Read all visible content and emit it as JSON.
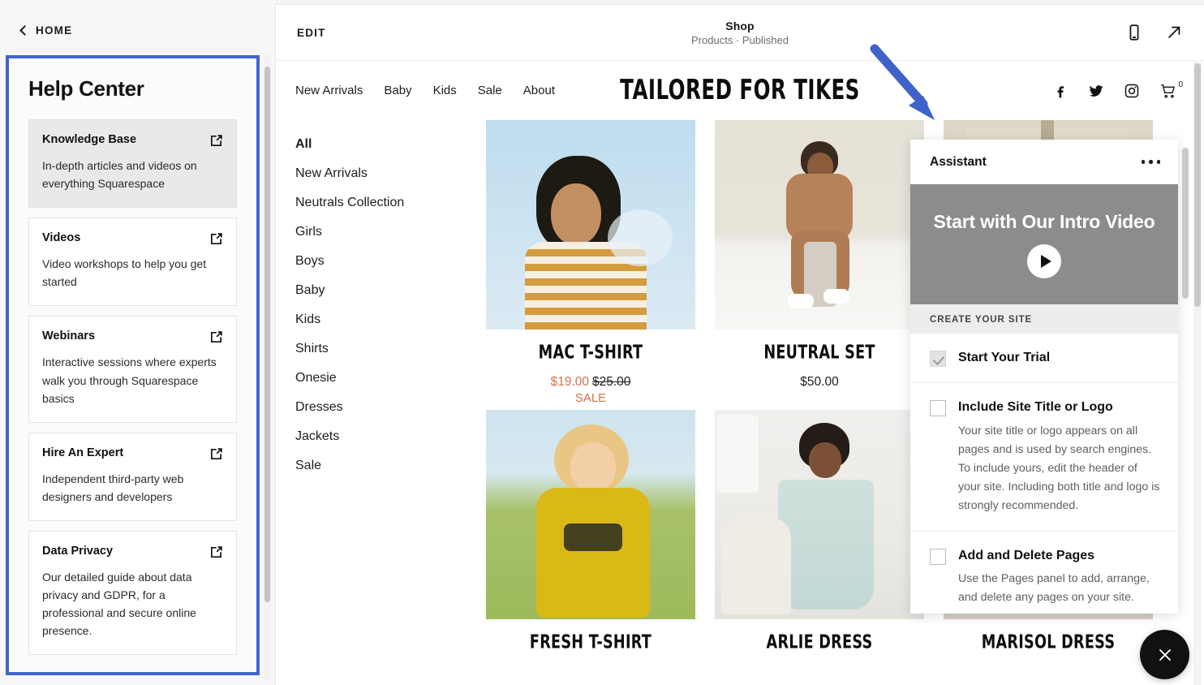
{
  "left_panel": {
    "back_label": "HOME",
    "back_icon": "chevron-left-icon",
    "title": "Help Center",
    "cards": [
      {
        "name": "Knowledge Base",
        "desc": "In-depth articles and videos on everything Squarespace",
        "icon": "external-link-icon",
        "active": true
      },
      {
        "name": "Videos",
        "desc": "Video workshops to help you get started",
        "icon": "external-link-icon",
        "active": false
      },
      {
        "name": "Webinars",
        "desc": "Interactive sessions where experts walk you through Squarespace basics",
        "icon": "external-link-icon",
        "active": false
      },
      {
        "name": "Hire An Expert",
        "desc": "Independent third-party web designers and developers",
        "icon": "external-link-icon",
        "active": false
      },
      {
        "name": "Data Privacy",
        "desc": "Our detailed guide about data privacy and GDPR, for a professional and secure online presence.",
        "icon": "external-link-icon",
        "active": false
      }
    ],
    "highlight_color": "#4264d0"
  },
  "topbar": {
    "edit_label": "EDIT",
    "page_title": "Shop",
    "page_subtitle": "Products · Published",
    "mobile_icon": "mobile-device-icon",
    "open_icon": "open-external-arrow-icon"
  },
  "site": {
    "brand": "TAILORED FOR TIKES",
    "nav": [
      {
        "label": "New Arrivals"
      },
      {
        "label": "Baby"
      },
      {
        "label": "Kids"
      },
      {
        "label": "Sale"
      },
      {
        "label": "About"
      }
    ],
    "social": [
      {
        "icon": "facebook-icon"
      },
      {
        "icon": "twitter-icon"
      },
      {
        "icon": "instagram-icon"
      }
    ],
    "cart": {
      "icon": "shopping-cart-icon",
      "count": "0"
    }
  },
  "categories": [
    {
      "label": "All",
      "active": true
    },
    {
      "label": "New Arrivals",
      "active": false
    },
    {
      "label": "Neutrals Collection",
      "active": false
    },
    {
      "label": "Girls",
      "active": false
    },
    {
      "label": "Boys",
      "active": false
    },
    {
      "label": "Baby",
      "active": false
    },
    {
      "label": "Kids",
      "active": false
    },
    {
      "label": "Shirts",
      "active": false
    },
    {
      "label": "Onesie",
      "active": false
    },
    {
      "label": "Dresses",
      "active": false
    },
    {
      "label": "Jackets",
      "active": false
    },
    {
      "label": "Sale",
      "active": false
    }
  ],
  "products": [
    {
      "title": "MAC T-SHIRT",
      "price": "$19.00",
      "original_price": "$25.00",
      "sale_label": "SALE",
      "on_sale": true
    },
    {
      "title": "NEUTRAL SET",
      "price": "$50.00",
      "original_price": "",
      "sale_label": "",
      "on_sale": false
    },
    {
      "title": "",
      "price": "",
      "original_price": "",
      "sale_label": "",
      "on_sale": false
    },
    {
      "title": "FRESH T-SHIRT",
      "price": "",
      "original_price": "",
      "sale_label": "",
      "on_sale": false
    },
    {
      "title": "ARLIE DRESS",
      "price": "",
      "original_price": "",
      "sale_label": "",
      "on_sale": false
    },
    {
      "title": "MARISOL DRESS",
      "price": "",
      "original_price": "",
      "sale_label": "",
      "on_sale": false
    }
  ],
  "assistant": {
    "title": "Assistant",
    "menu_icon": "more-options-icon",
    "video": {
      "title": "Start with Our Intro Video",
      "play_icon": "play-icon"
    },
    "section_label": "CREATE YOUR SITE",
    "items": [
      {
        "title": "Start Your Trial",
        "desc": "",
        "checked": true
      },
      {
        "title": "Include Site Title or Logo",
        "desc": "Your site title or logo appears on all pages and is used by search engines. To include yours, edit the header of your site. Including both title and logo is strongly recommended.",
        "checked": false
      },
      {
        "title": "Add and Delete Pages",
        "desc": "Use the Pages panel to add, arrange, and delete any pages on your site.",
        "checked": false
      }
    ]
  },
  "close_button": {
    "icon": "close-icon",
    "label": "×"
  },
  "annotation": {
    "type": "arrow",
    "color": "#3f62c9"
  },
  "colors": {
    "highlight_blue": "#4264d0",
    "sale_orange": "#d1724b",
    "video_grey": "#8c8c8c"
  }
}
